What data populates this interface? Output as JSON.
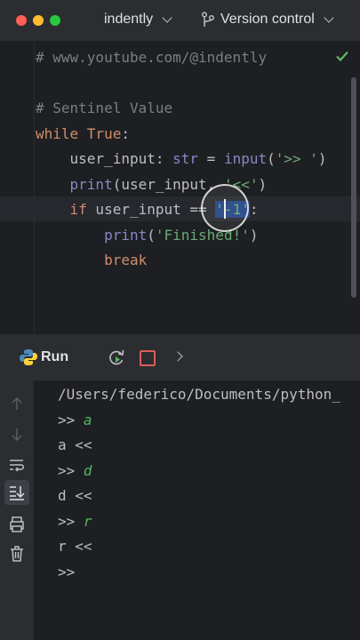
{
  "titlebar": {
    "project": "indently",
    "vcs": "Version control"
  },
  "editor": {
    "lines": [
      {
        "parts": [
          {
            "t": "# www.youtube.com/@indently",
            "c": "cmt"
          }
        ]
      },
      {
        "parts": []
      },
      {
        "parts": [
          {
            "t": "# Sentinel Value",
            "c": "cmt"
          }
        ]
      },
      {
        "parts": [
          {
            "t": "while ",
            "c": "kw"
          },
          {
            "t": "True",
            "c": "kw"
          },
          {
            "t": ":",
            "c": "plain"
          }
        ]
      },
      {
        "parts": [
          {
            "t": "    user_input: ",
            "c": "plain"
          },
          {
            "t": "str",
            "c": "bi"
          },
          {
            "t": " = ",
            "c": "plain"
          },
          {
            "t": "input",
            "c": "bi"
          },
          {
            "t": "(",
            "c": "plain"
          },
          {
            "t": "'>> '",
            "c": "str"
          },
          {
            "t": ")",
            "c": "plain"
          }
        ]
      },
      {
        "parts": [
          {
            "t": "    ",
            "c": "plain"
          },
          {
            "t": "print",
            "c": "bi"
          },
          {
            "t": "(user_input, ",
            "c": "plain"
          },
          {
            "t": "'<<'",
            "c": "str"
          },
          {
            "t": ")",
            "c": "plain"
          }
        ]
      },
      {
        "parts": [
          {
            "t": "    ",
            "c": "plain"
          },
          {
            "t": "if",
            "c": "kw"
          },
          {
            "t": " user_input == ",
            "c": "plain"
          },
          {
            "t": "'-1'",
            "c": "str sel"
          },
          {
            "t": ":",
            "c": "plain"
          }
        ]
      },
      {
        "parts": [
          {
            "t": "        ",
            "c": "plain"
          },
          {
            "t": "print",
            "c": "bi"
          },
          {
            "t": "(",
            "c": "plain"
          },
          {
            "t": "'Finished!'",
            "c": "str"
          },
          {
            "t": ")",
            "c": "plain"
          }
        ]
      },
      {
        "parts": [
          {
            "t": "        ",
            "c": "plain"
          },
          {
            "t": "break",
            "c": "kw"
          }
        ]
      }
    ]
  },
  "run": {
    "title": "Run"
  },
  "console": {
    "lines": [
      {
        "parts": [
          {
            "t": "/Users/federico/Documents/python_",
            "c": ""
          }
        ]
      },
      {
        "parts": [
          {
            "t": ">> ",
            "c": ""
          },
          {
            "t": "a",
            "c": "inp"
          }
        ]
      },
      {
        "parts": [
          {
            "t": "a <<",
            "c": ""
          }
        ]
      },
      {
        "parts": [
          {
            "t": ">> ",
            "c": ""
          },
          {
            "t": "d",
            "c": "inp"
          }
        ]
      },
      {
        "parts": [
          {
            "t": "d <<",
            "c": ""
          }
        ]
      },
      {
        "parts": [
          {
            "t": ">> ",
            "c": ""
          },
          {
            "t": "r",
            "c": "inp"
          }
        ]
      },
      {
        "parts": [
          {
            "t": "r <<",
            "c": ""
          }
        ]
      },
      {
        "parts": [
          {
            "t": ">>",
            "c": ""
          }
        ]
      }
    ]
  },
  "icons": {
    "branch": "vcs-branch-icon",
    "check": "check-icon",
    "python": "python-icon",
    "rerun": "rerun-icon",
    "stop": "stop-icon",
    "more": "chevron-right-icon"
  }
}
